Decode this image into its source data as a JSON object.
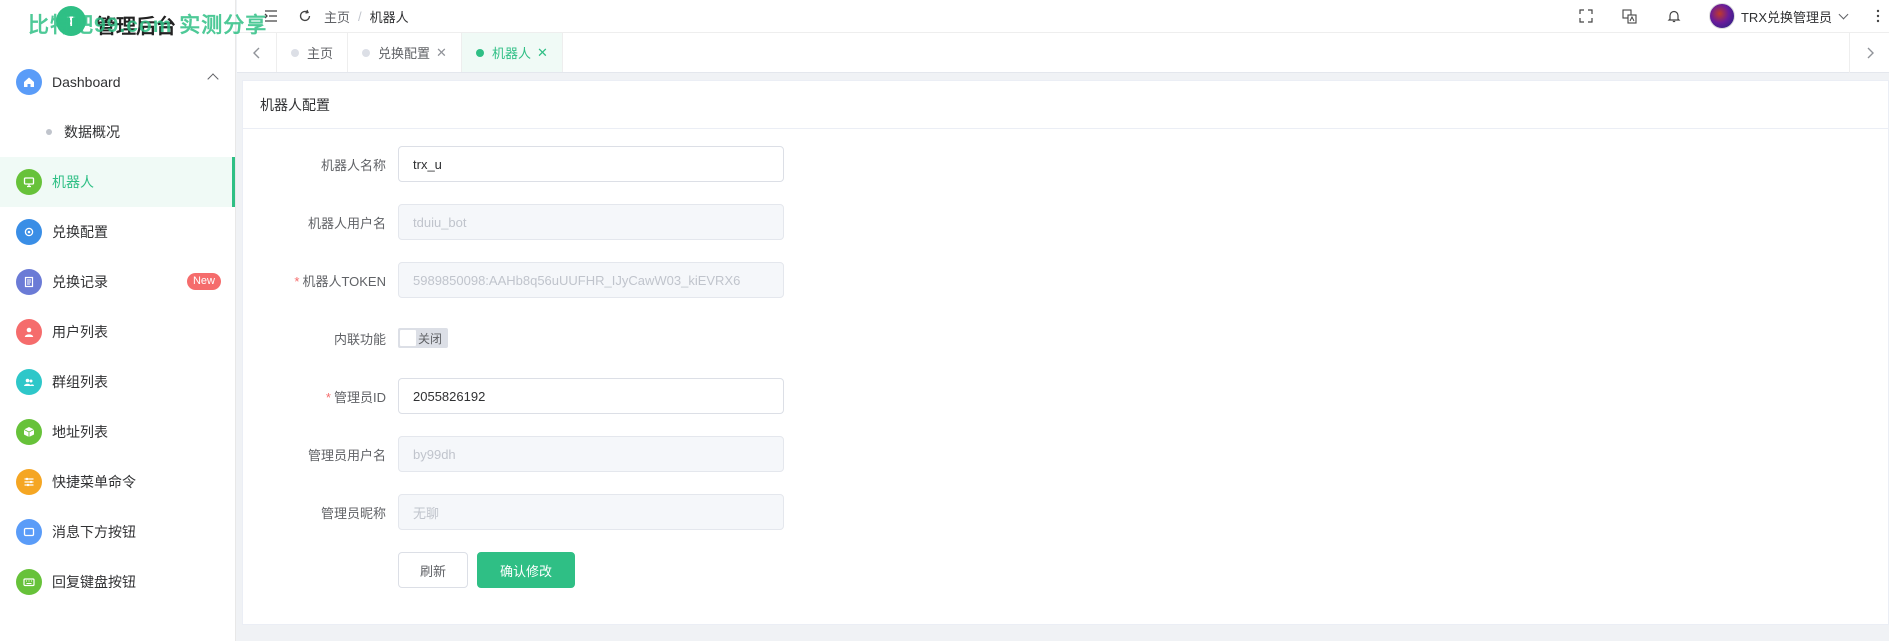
{
  "watermark": "比特吧99.com 实测分享",
  "logo": {
    "letter": "T",
    "title": "管理后台"
  },
  "sidebar": {
    "items": [
      {
        "label": "Dashboard",
        "color": "#5a9cf8",
        "icon": "home-icon"
      },
      {
        "label": "数据概况"
      },
      {
        "label": "机器人",
        "color": "#67c23a",
        "icon": "monitor-icon"
      },
      {
        "label": "兑换配置",
        "color": "#3a8ee6",
        "icon": "gear-icon"
      },
      {
        "label": "兑换记录",
        "color": "#6b7bd6",
        "icon": "document-icon",
        "badge": "New"
      },
      {
        "label": "用户列表",
        "color": "#f56c6c",
        "icon": "user-icon"
      },
      {
        "label": "群组列表",
        "color": "#2ec7c9",
        "icon": "group-icon"
      },
      {
        "label": "地址列表",
        "color": "#67c23a",
        "icon": "box-icon"
      },
      {
        "label": "快捷菜单命令",
        "color": "#f5a623",
        "icon": "sliders-icon"
      },
      {
        "label": "消息下方按钮",
        "color": "#5a9cf8",
        "icon": "card-icon"
      },
      {
        "label": "回复键盘按钮",
        "color": "#67c23a",
        "icon": "keyboard-icon"
      }
    ]
  },
  "header": {
    "breadcrumb": [
      "主页",
      "机器人"
    ],
    "user": "TRX兑换管理员"
  },
  "tabs": [
    {
      "label": "主页",
      "closable": false
    },
    {
      "label": "兑换配置",
      "closable": true
    },
    {
      "label": "机器人",
      "closable": true
    }
  ],
  "card": {
    "title": "机器人配置",
    "fields": [
      {
        "label": "机器人名称",
        "value": "trx_u",
        "disabled": false,
        "required": false
      },
      {
        "label": "机器人用户名",
        "value": "tduiu_bot",
        "disabled": true,
        "required": false
      },
      {
        "label": "机器人TOKEN",
        "value": "5989850098:AAHb8q56uUUFHR_IJyCawW03_kiEVRX6",
        "disabled": true,
        "required": true
      },
      {
        "label": "内联功能",
        "switch_text": "关闭"
      },
      {
        "label": "管理员ID",
        "value": "2055826192",
        "disabled": false,
        "required": true
      },
      {
        "label": "管理员用户名",
        "value": "by99dh",
        "disabled": true,
        "required": false
      },
      {
        "label": "管理员昵称",
        "value": "无聊",
        "disabled": true,
        "required": false
      }
    ],
    "refresh_label": "刷新",
    "submit_label": "确认修改"
  },
  "colors": {
    "primary": "#2fbf85",
    "danger": "#f56c6c"
  }
}
